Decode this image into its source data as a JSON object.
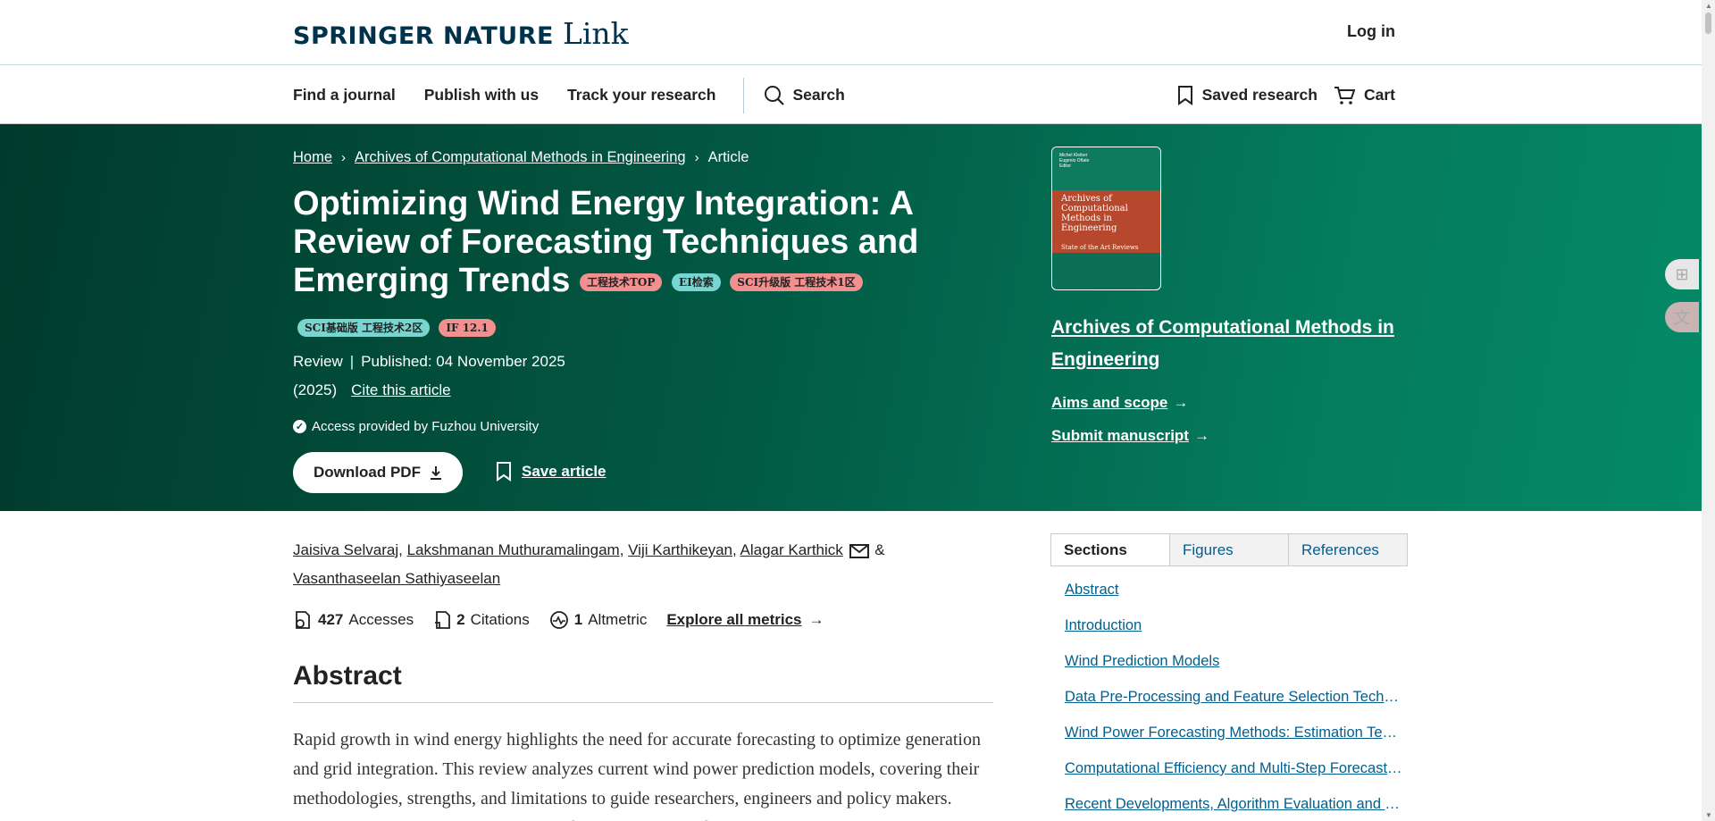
{
  "header": {
    "brand": "SPRINGER NATURE",
    "brand_suffix": "Link",
    "login": "Log in"
  },
  "nav": {
    "items": [
      "Find a journal",
      "Publish with us",
      "Track your research"
    ],
    "search": "Search",
    "saved": "Saved research",
    "cart": "Cart"
  },
  "breadcrumb": {
    "home": "Home",
    "journal": "Archives of Computational Methods in Engineering",
    "current": "Article"
  },
  "article": {
    "title": "Optimizing Wind Energy Integration: A Review of Forecasting Techniques and Emerging Trends",
    "badges": [
      "工程技术TOP",
      "EI检索",
      "SCI升级版 工程技术1区",
      "SCI基础版 工程技术2区",
      "IF 12.1"
    ],
    "type": "Review",
    "published": "Published: 04 November 2025",
    "year": "(2025)",
    "cite": "Cite this article",
    "access": "Access provided by Fuzhou University",
    "download": "Download PDF",
    "save": "Save article"
  },
  "journal": {
    "name": "Archives of Computational Methods in Engineering",
    "aims": "Aims and scope",
    "submit": "Submit manuscript",
    "cover_title": "Archives of Computational Methods in Engineering",
    "cover_subtitle": "State of the Art Reviews",
    "cover_authors": "Michel Kleiber\nEugenio Oñate\nEditor"
  },
  "authors": [
    "Jaisiva Selvaraj",
    "Lakshmanan Muthuramalingam",
    "Viji Karthikeyan",
    "Alagar Karthick",
    "Vasanthaseelan Sathiyaseelan"
  ],
  "metrics": {
    "accesses_count": "427",
    "accesses_label": "Accesses",
    "citations_count": "2",
    "citations_label": "Citations",
    "altmetric_count": "1",
    "altmetric_label": "Altmetric",
    "explore": "Explore all metrics"
  },
  "abstract": {
    "heading": "Abstract",
    "text": "Rapid growth in wind energy highlights the need for accurate forecasting to optimize generation and grid integration. This review analyzes current wind power prediction models, covering their methodologies, strengths, and limitations to guide researchers, engineers and policy makers. Selecting with Numerical Weather Prediction (NWP) models"
  },
  "sidebar": {
    "tabs": [
      "Sections",
      "Figures",
      "References"
    ],
    "toc": [
      "Abstract",
      "Introduction",
      "Wind Prediction Models",
      "Data Pre-Processing and Feature Selection Techniques",
      "Wind Power Forecasting Methods: Estimation Techniques",
      "Computational Efficiency and Multi-Step Forecasting",
      "Recent Developments, Algorithm Evaluation and Trends"
    ]
  },
  "colors": {
    "hero_dark": "#013a2c",
    "hero_light": "#048a67",
    "link_blue": "#025e8d",
    "brand_navy": "#01324b",
    "badge_red": "#f28f8f",
    "badge_teal": "#77d6d0"
  }
}
